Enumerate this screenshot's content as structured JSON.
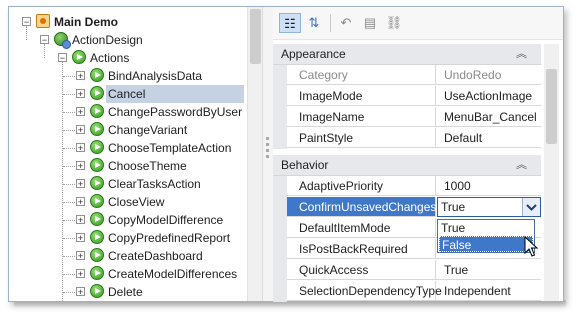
{
  "tree": {
    "root": {
      "label": "Main Demo",
      "icon": "demo-icon"
    },
    "design": {
      "label": "ActionDesign",
      "icon": "action-design-icon"
    },
    "actions": {
      "label": "Actions",
      "icon": "actions-icon"
    },
    "items": [
      {
        "label": "BindAnalysisData",
        "selected": false
      },
      {
        "label": "Cancel",
        "selected": true
      },
      {
        "label": "ChangePasswordByUser",
        "selected": false
      },
      {
        "label": "ChangeVariant",
        "selected": false
      },
      {
        "label": "ChooseTemplateAction",
        "selected": false
      },
      {
        "label": "ChooseTheme",
        "selected": false
      },
      {
        "label": "ClearTasksAction",
        "selected": false
      },
      {
        "label": "CloseView",
        "selected": false
      },
      {
        "label": "CopyModelDifference",
        "selected": false
      },
      {
        "label": "CopyPredefinedReport",
        "selected": false
      },
      {
        "label": "CreateDashboard",
        "selected": false
      },
      {
        "label": "CreateModelDifferences",
        "selected": false
      },
      {
        "label": "Delete",
        "selected": false
      }
    ]
  },
  "toolbar": {
    "buttons": [
      {
        "name": "categorized-button",
        "icon": "categorized-icon",
        "glyph": "☷",
        "active": true
      },
      {
        "name": "alphabetical-button",
        "icon": "sort-az-icon",
        "glyph": "⇅",
        "active": false
      },
      {
        "name": "undo-button",
        "icon": "undo-icon",
        "glyph": "↶",
        "active": false
      },
      {
        "name": "properties-button",
        "icon": "properties-icon",
        "glyph": "▤",
        "active": false
      },
      {
        "name": "link-button",
        "icon": "link-icon",
        "glyph": "⛓",
        "active": false
      }
    ]
  },
  "property_grid": {
    "categories": [
      {
        "label": "Appearance",
        "properties": [
          {
            "name": "Category",
            "value": "UndoRedo",
            "muted": true
          },
          {
            "name": "ImageMode",
            "value": "UseActionImage",
            "muted": false
          },
          {
            "name": "ImageName",
            "value": "MenuBar_Cancel",
            "muted": false
          },
          {
            "name": "PaintStyle",
            "value": "Default",
            "muted": false
          }
        ]
      },
      {
        "label": "Behavior",
        "properties": [
          {
            "name": "AdaptivePriority",
            "value": "1000",
            "muted": false
          },
          {
            "name": "ConfirmUnsavedChanges",
            "value": "True",
            "muted": false,
            "selected": true
          },
          {
            "name": "DefaultItemMode",
            "value": "",
            "muted": false
          },
          {
            "name": "IsPostBackRequired",
            "value": "",
            "muted": false
          },
          {
            "name": "QuickAccess",
            "value": "True",
            "muted": false
          },
          {
            "name": "SelectionDependencyType",
            "value": "Independent",
            "muted": false
          }
        ]
      }
    ],
    "dropdown": {
      "options": [
        "True",
        "False"
      ],
      "highlighted": "False"
    }
  },
  "colors": {
    "selection": "#3f78c8",
    "tree_selection": "#c5d2e3",
    "category_band": "#e6e8ec",
    "frame_border": "#9fb3c8"
  }
}
